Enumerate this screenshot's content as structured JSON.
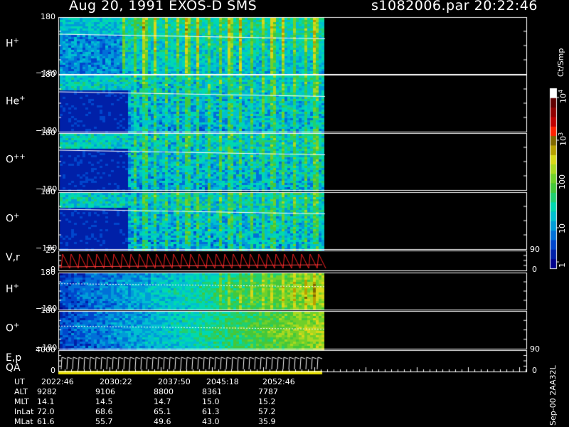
{
  "header": {
    "title": "Aug 20, 1991   EXOS-D SMS",
    "file_time": "s1082006.par  20:22:46"
  },
  "colorbar": {
    "unit": "Ct/Smp",
    "ticks": [
      {
        "label": "1"
      },
      {
        "label": "10"
      },
      {
        "label": "100"
      },
      {
        "label": "10",
        "sup": "3"
      },
      {
        "label": "10",
        "sup": "4"
      }
    ],
    "colors": [
      "#00008b",
      "#0020a8",
      "#0046cc",
      "#0070d8",
      "#009cd8",
      "#00c0d0",
      "#00d8b0",
      "#20d070",
      "#44c83a",
      "#70d02a",
      "#a8d820",
      "#d8d818",
      "#b8a000",
      "#806800",
      "#ff2000",
      "#c00000",
      "#900000",
      "#600000",
      "#ffffff"
    ]
  },
  "footer": {
    "rows": [
      {
        "label": "UT",
        "values": [
          "2022:46",
          "2030:22",
          "2037:50",
          "2045:18",
          "2052:46"
        ]
      },
      {
        "label": "ALT",
        "values": [
          "9282",
          "9106",
          "8800",
          "8361",
          "7787"
        ]
      },
      {
        "label": "MLT",
        "values": [
          "14.1",
          "14.5",
          "14.7",
          "15.0",
          "15.2"
        ]
      },
      {
        "label": "InLat",
        "values": [
          "72.0",
          "68.6",
          "65.1",
          "61.3",
          "57.2"
        ]
      },
      {
        "label": "MLat",
        "values": [
          "61.6",
          "55.7",
          "49.6",
          "43.0",
          "35.9"
        ]
      }
    ],
    "version": "Sep-00  2AA32L"
  },
  "chart_data": {
    "type": "heatmap",
    "x_range": [
      "20:22:46",
      "20:55:00"
    ],
    "panels": [
      {
        "label": "H",
        "charge": "+",
        "ytop": "180",
        "ybottom": "−180",
        "ticks_right": []
      },
      {
        "label": "He",
        "charge": "+",
        "ytop": "180",
        "ybottom": "−180",
        "ticks_right": []
      },
      {
        "label": "O",
        "charge": "++",
        "ytop": "180",
        "ybottom": "−180",
        "ticks_right": []
      },
      {
        "label": "O",
        "charge": "+",
        "ytop": "180",
        "ybottom": "−180",
        "ticks_right": []
      },
      {
        "label": "V,r",
        "charge": "",
        "ytop": "25",
        "ybottom": "0",
        "ticks_right": [
          "90",
          "0"
        ]
      },
      {
        "label": "H",
        "charge": "+",
        "ytop": "180",
        "ybottom": "−180",
        "ticks_right": []
      },
      {
        "label": "O",
        "charge": "+",
        "ytop": "180",
        "ybottom": "−180",
        "ticks_right": []
      },
      {
        "label": "E,p",
        "charge": "",
        "ytop": "4000",
        "ybottom": "0",
        "ticks_right": [
          "90",
          "0"
        ]
      }
    ],
    "qa_label": "QA"
  }
}
